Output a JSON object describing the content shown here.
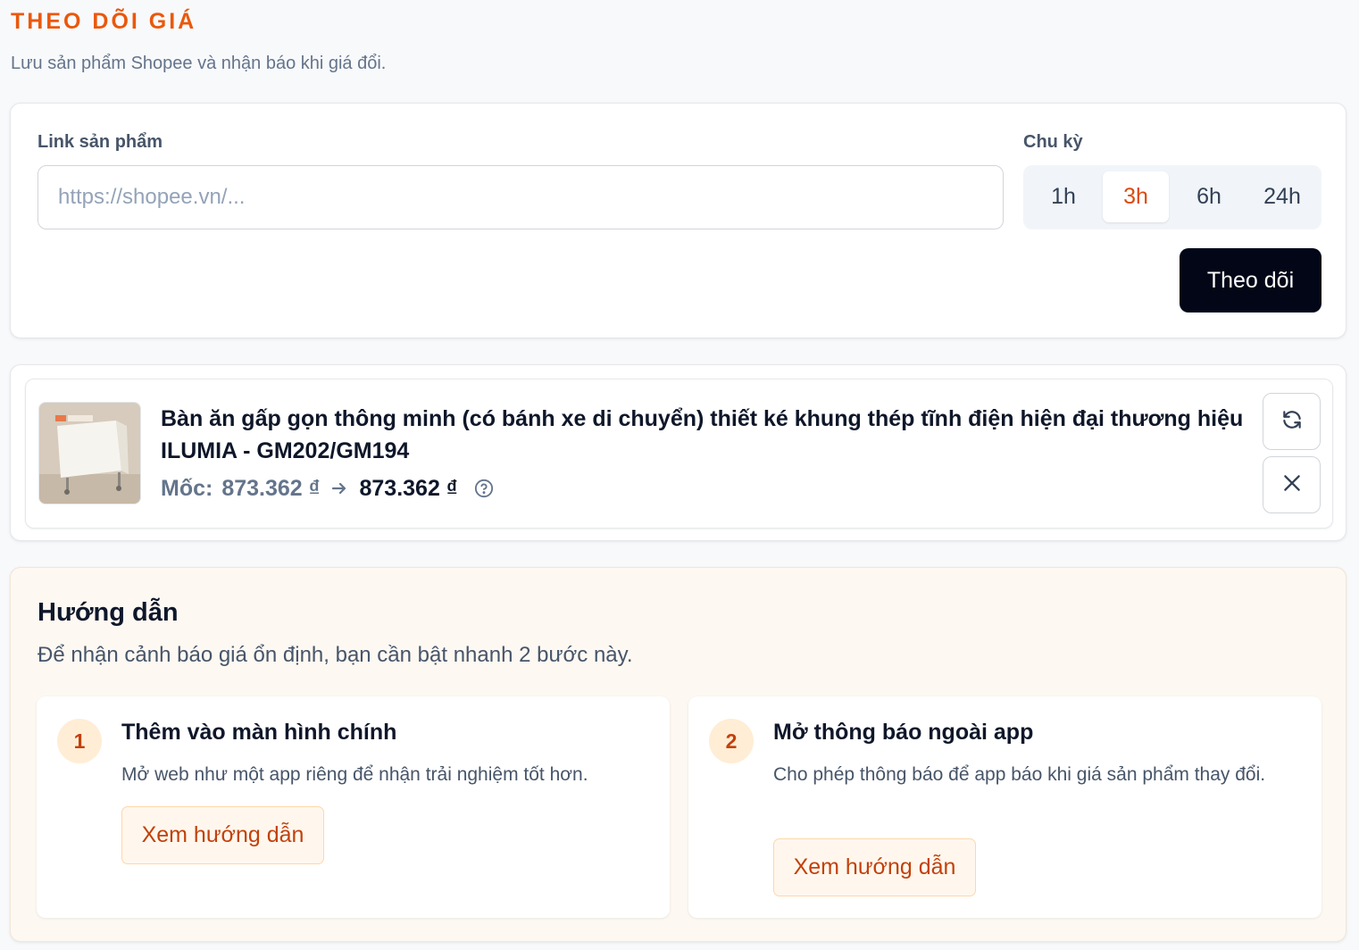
{
  "header": {
    "title": "THEO DÕI GIÁ",
    "subtitle": "Lưu sản phẩm Shopee và nhận báo khi giá đổi."
  },
  "form": {
    "link_label": "Link sản phẩm",
    "link_placeholder": "https://shopee.vn/...",
    "link_value": "",
    "period_label": "Chu kỳ",
    "periods": [
      "1h",
      "3h",
      "6h",
      "24h"
    ],
    "selected_period": "3h",
    "submit_label": "Theo dõi"
  },
  "products": [
    {
      "name": "Bàn ăn gấp gọn thông minh (có bánh xe di chuyển) thiết ké khung thép tĩnh điện hiện đại thương hiệu ILUMIA - GM202/GM194",
      "price_label": "Mốc:",
      "base_price": "873.362 ₫",
      "current_price": "873.362 ₫",
      "image_icon": "product-thumbnail"
    }
  ],
  "guide": {
    "title": "Hướng dẫn",
    "subtitle": "Để nhận cảnh báo giá ổn định, bạn cần bật nhanh 2 bước này.",
    "steps": [
      {
        "number": "1",
        "title": "Thêm vào màn hình chính",
        "description": "Mở web như một app riêng để nhận trải nghiệm tốt hơn.",
        "button_label": "Xem hướng dẫn"
      },
      {
        "number": "2",
        "title": "Mở thông báo ngoài app",
        "description": "Cho phép thông báo để app báo khi giá sản phẩm thay đổi.",
        "button_label": "Xem hướng dẫn"
      }
    ]
  },
  "colors": {
    "accent": "#ea580c",
    "primary_button": "#020617",
    "guide_background": "#fdf8f2"
  }
}
